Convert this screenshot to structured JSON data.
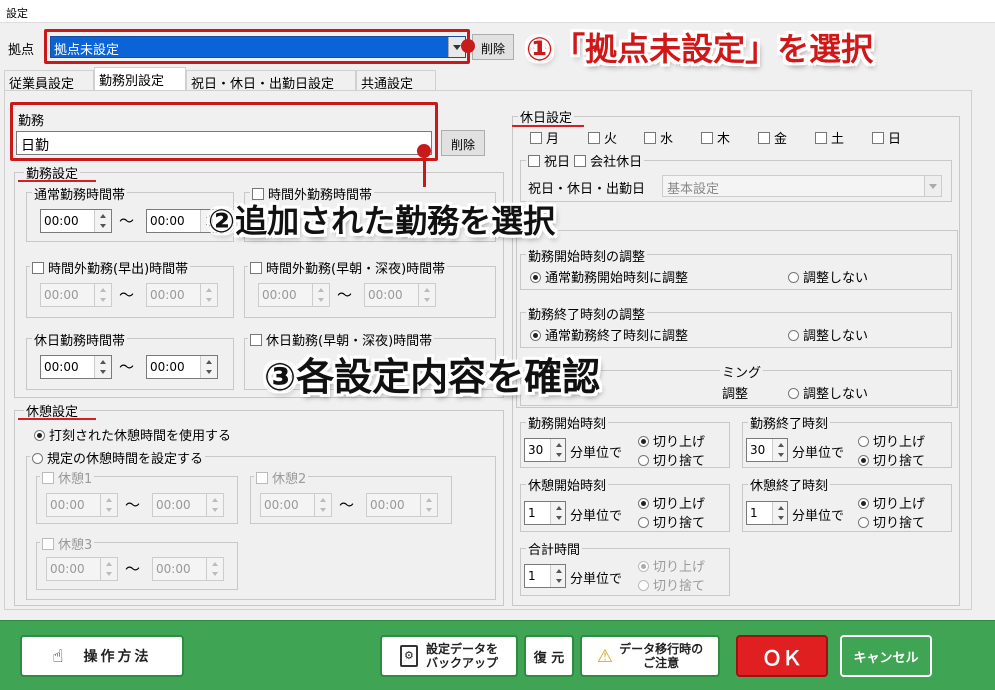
{
  "window": {
    "title": "設定"
  },
  "location": {
    "label": "拠点",
    "value": "拠点未設定",
    "delete_label": "削除"
  },
  "tabs": [
    {
      "label": "従業員設定"
    },
    {
      "label": "勤務別設定"
    },
    {
      "label": "祝日・休日・出勤日設定"
    },
    {
      "label": "共通設定"
    }
  ],
  "shift": {
    "label": "勤務",
    "value": "日勤",
    "delete_label": "削除"
  },
  "work_settings": {
    "title": "勤務設定",
    "normal": {
      "label": "通常勤務時間帯",
      "from": "00:00",
      "to": "00:00"
    },
    "overtime_hidden": {
      "label": "時間外勤務時間帯"
    },
    "early": {
      "label": "時間外勤務(早出)時間帯",
      "from": "00:00",
      "to": "00:00"
    },
    "late": {
      "label": "時間外勤務(早朝・深夜)時間帯",
      "from": "00:00",
      "to": "00:00"
    },
    "holiday": {
      "label": "休日勤務時間帯",
      "from": "00:00",
      "to": "00:00"
    },
    "holiday_late": {
      "label": "休日勤務(早朝・深夜)時間帯"
    }
  },
  "break_settings": {
    "title": "休憩設定",
    "option_punched": "打刻された休憩時間を使用する",
    "option_fixed": "規定の休憩時間を設定する",
    "break1": {
      "label": "休憩1",
      "from": "00:00",
      "to": "00:00"
    },
    "break2": {
      "label": "休憩2",
      "from": "00:00",
      "to": "00:00"
    },
    "break3": {
      "label": "休憩3",
      "from": "00:00",
      "to": "00:00"
    }
  },
  "holiday_settings": {
    "title": "休日設定",
    "days": [
      "月",
      "火",
      "水",
      "木",
      "金",
      "土",
      "日"
    ],
    "national_holiday": "祝日",
    "company_holiday": "会社休日",
    "combo_label": "祝日・休日・出勤日",
    "combo_value": "基本設定"
  },
  "adjust_start": {
    "title": "勤務開始時刻の調整",
    "opt1": "通常勤務開始時刻に調整",
    "opt2": "調整しない"
  },
  "adjust_end": {
    "title": "勤務終了時刻の調整",
    "opt1": "通常勤務終了時刻に調整",
    "opt2": "調整しない"
  },
  "adjust_timing": {
    "title_tail": "ミング",
    "opt1_tail": "調整",
    "opt2": "調整しない"
  },
  "rounding": {
    "unit_suffix": "分単位で",
    "round_up": "切り上げ",
    "round_down": "切り捨て",
    "work_start": {
      "title": "勤務開始時刻",
      "value": "30"
    },
    "work_end": {
      "title": "勤務終了時刻",
      "value": "30"
    },
    "break_start": {
      "title": "休憩開始時刻",
      "value": "1"
    },
    "break_end": {
      "title": "休憩終了時刻",
      "value": "1"
    },
    "total": {
      "title": "合計時間",
      "value": "1"
    }
  },
  "footer": {
    "howto": "操作方法",
    "backup": "設定データを\nバックアップ",
    "restore": "復 元",
    "migration": "データ移行時の\nご注意",
    "ok": "ＯＫ",
    "cancel": "キャンセル"
  },
  "annotations": {
    "step1": "①「拠点未設定」を選択",
    "step2": "②追加された勤務を選択",
    "step3": "③各設定内容を確認"
  },
  "colors": {
    "accent_red": "#c81a1a",
    "footer_green": "#3fa454",
    "ok_red": "#e02020",
    "select_blue": "#0a64d8"
  }
}
